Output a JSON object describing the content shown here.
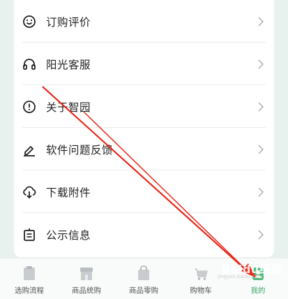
{
  "menu": [
    {
      "label": "订购评价",
      "icon": "smile-icon"
    },
    {
      "label": "阳光客服",
      "icon": "headset-icon"
    },
    {
      "label": "关于智园",
      "icon": "info-icon"
    },
    {
      "label": "软件问题反馈",
      "icon": "edit-icon"
    },
    {
      "label": "下载附件",
      "icon": "cloud-download-icon"
    },
    {
      "label": "公示信息",
      "icon": "notice-icon"
    }
  ],
  "tabs": [
    {
      "label": "选购流程",
      "icon": "clipboard-icon",
      "active": false
    },
    {
      "label": "商品统购",
      "icon": "store-icon",
      "active": false
    },
    {
      "label": "商品零购",
      "icon": "bag-icon",
      "active": false
    },
    {
      "label": "购物车",
      "icon": "cart-icon",
      "active": false
    },
    {
      "label": "我的",
      "icon": "profile-icon",
      "active": true
    }
  ],
  "watermark": {
    "text": "Baidu经验",
    "sub": "jingyan.baidu.com"
  },
  "colors": {
    "accent": "#3aaa6a",
    "annotation_arrow": "#e8291c",
    "tab_icon": "#c9ccce"
  }
}
